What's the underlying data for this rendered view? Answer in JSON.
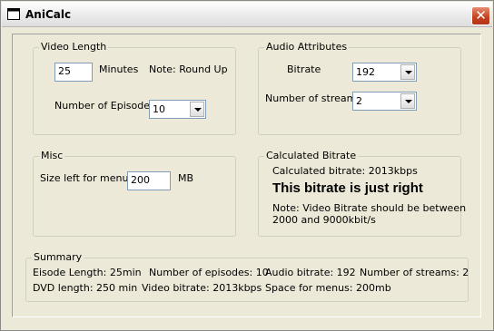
{
  "window": {
    "title": "AniCalc"
  },
  "video_length": {
    "legend": "Video Length",
    "minutes_value": "25",
    "minutes_label": "Minutes",
    "note": "Note: Round Up",
    "episodes_label": "Number of Episodes",
    "episodes_value": "10"
  },
  "audio": {
    "legend": "Audio Attributes",
    "bitrate_label": "Bitrate",
    "bitrate_value": "192",
    "streams_label": "Number of streams",
    "streams_value": "2"
  },
  "misc": {
    "legend": "Misc",
    "menu_label": "Size left for menu",
    "menu_value": "200",
    "menu_unit": "MB"
  },
  "calculated": {
    "legend": "Calculated Bitrate",
    "bitrate_text": "Calculated bitrate: 2013kbps",
    "verdict": "This bitrate is just right",
    "note_line1": "Note: Video Bitrate should be between",
    "note_line2": "2000 and 9000kbit/s"
  },
  "summary": {
    "legend": "Summary",
    "episode_length": "Eisode Length: 25min",
    "num_episodes": "Number of episodes: 10",
    "audio_bitrate": "Audio bitrate: 192",
    "num_streams": "Number of streams: 2",
    "dvd_length": "DVD length: 250 min",
    "video_bitrate": "Video bitrate: 2013kbps",
    "menu_space": "Space for menus: 200mb"
  }
}
